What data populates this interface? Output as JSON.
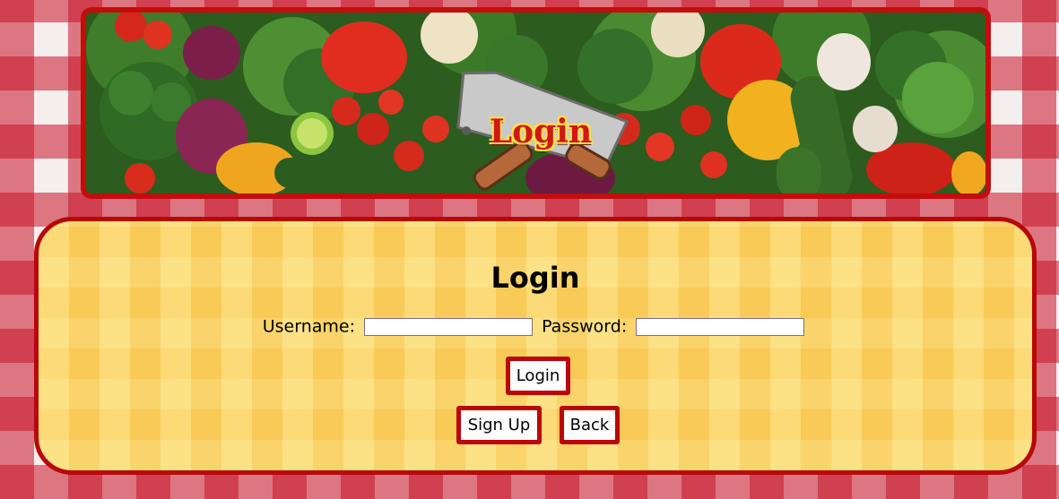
{
  "banner": {
    "logo_text": "Login",
    "logo_icon": "cleaver-knife-icon"
  },
  "panel": {
    "title": "Login",
    "username_label": "Username:",
    "password_label": "Password:",
    "username_value": "",
    "password_value": ""
  },
  "buttons": {
    "login": "Login",
    "sign_up": "Sign Up",
    "back": "Back"
  },
  "colors": {
    "accent_red": "#b80808",
    "panel_yellow": "#fbd15f",
    "tablecloth_red": "#c81428"
  }
}
